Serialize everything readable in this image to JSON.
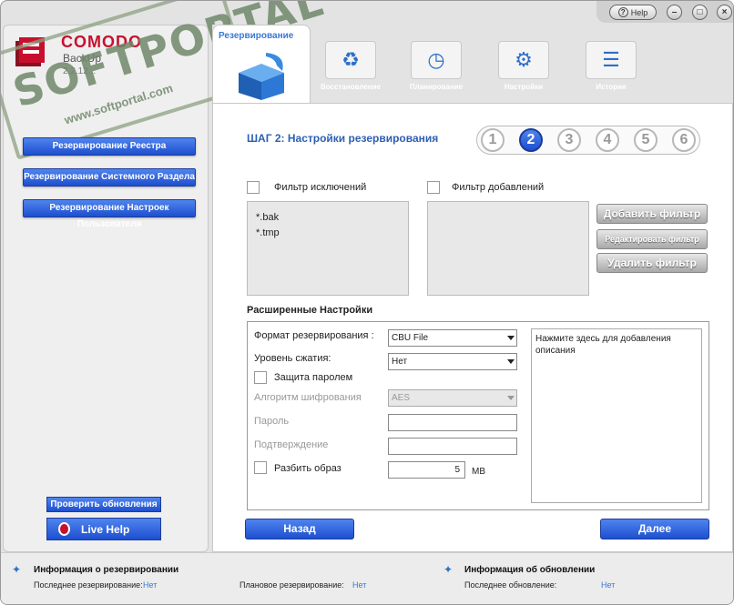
{
  "app": {
    "brand": "COMODO",
    "product": "BackUp",
    "version": "2.2.12..."
  },
  "watermark": {
    "text": "SOFTPORTAL",
    "sub": "www.softportal.com",
    "mark": "™"
  },
  "titlebar": {
    "help": "Help"
  },
  "sidebar": {
    "buttons": [
      "Резервирование Реестра",
      "Резервирование Системного Раздела",
      "Резервирование Настроек Пользователя"
    ],
    "update": "Проверить обновления",
    "live_help": "Live Help"
  },
  "tabs": {
    "active": "Резервирование",
    "items": [
      "Восстановление",
      "Планирование",
      "Настройки",
      "История"
    ]
  },
  "step": {
    "title": "ШАГ 2: Настройки резервирования",
    "numbers": [
      "1",
      "2",
      "3",
      "4",
      "5",
      "6"
    ],
    "active": "2"
  },
  "filters": {
    "exclude_label": "Фильтр исключений",
    "include_label": "Фильтр добавлений",
    "exclude_items": [
      "*.bak",
      "*.tmp"
    ],
    "add": "Добавить фильтр",
    "edit": "Редактировать фильтр",
    "remove": "Удалить фильтр"
  },
  "advanced": {
    "title": "Расширенные Настройки",
    "format_label": "Формат резервирования :",
    "format_value": "CBU File",
    "compression_label": "Уровень сжатия:",
    "compression_value": "Нет",
    "password_protect": "Защита паролем",
    "encryption_label": "Алгоритм шифрования",
    "encryption_value": "AES",
    "password_label": "Пароль",
    "confirm_label": "Подтверждение",
    "split_label": "Разбить образ",
    "split_value": "5",
    "split_unit": "MB",
    "description": "Нажмите здесь для добавления описания"
  },
  "nav": {
    "back": "Назад",
    "next": "Далее"
  },
  "status": {
    "backup_header": "Информация о резервировании",
    "last_backup_label": "Последнее резервирование:",
    "last_backup_value": "Нет",
    "scheduled_label": "Плановое резервирование:",
    "scheduled_value": "Нет",
    "update_header": "Информация об обновлении",
    "last_update_label": "Последнее обновление:",
    "last_update_value": "Нет"
  }
}
